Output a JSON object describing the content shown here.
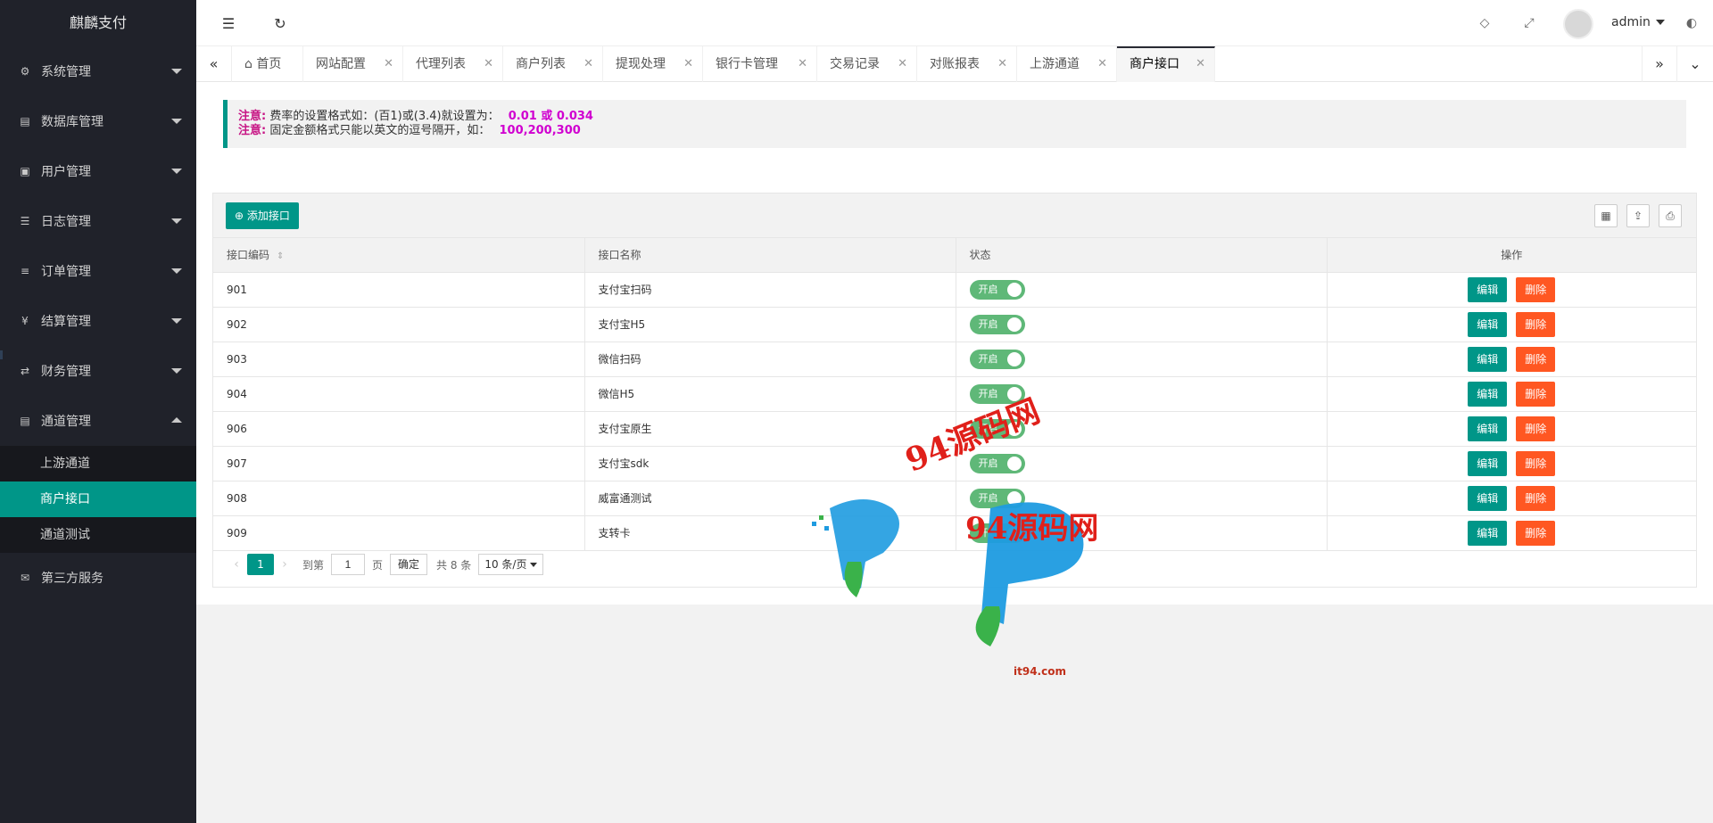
{
  "app": {
    "title": "麒麟支付"
  },
  "sidebar": {
    "items": [
      {
        "label": "系统管理",
        "icon": "gear-icon",
        "glyph": "⚙"
      },
      {
        "label": "数据库管理",
        "icon": "database-icon",
        "glyph": "▤"
      },
      {
        "label": "用户管理",
        "icon": "users-icon",
        "glyph": "▣"
      },
      {
        "label": "日志管理",
        "icon": "log-icon",
        "glyph": "☰"
      },
      {
        "label": "订单管理",
        "icon": "list-icon",
        "glyph": "≡"
      },
      {
        "label": "结算管理",
        "icon": "yen-icon",
        "glyph": "¥"
      },
      {
        "label": "财务管理",
        "icon": "exchange-icon",
        "glyph": "⇄"
      },
      {
        "label": "通道管理",
        "icon": "server-icon",
        "glyph": "▤",
        "expanded": true,
        "children": [
          {
            "label": "上游通道"
          },
          {
            "label": "商户接口",
            "active": true
          },
          {
            "label": "通道测试"
          }
        ]
      },
      {
        "label": "第三方服务",
        "icon": "mail-icon",
        "glyph": "✉"
      }
    ]
  },
  "header": {
    "username": "admin"
  },
  "tabs": {
    "items": [
      {
        "label": "首页",
        "home": true
      },
      {
        "label": "网站配置"
      },
      {
        "label": "代理列表"
      },
      {
        "label": "商户列表"
      },
      {
        "label": "提现处理"
      },
      {
        "label": "银行卡管理"
      },
      {
        "label": "交易记录"
      },
      {
        "label": "对账报表"
      },
      {
        "label": "上游通道"
      },
      {
        "label": "商户接口",
        "active": true
      }
    ]
  },
  "notice": {
    "line1": {
      "label": "注意:",
      "text": "费率的设置格式如：(百1)或(3.4)就设置为：",
      "highlight": "0.01 或 0.034"
    },
    "line2": {
      "label": "注意:",
      "text": "固定金额格式只能以英文的逗号隔开，如：",
      "highlight": "100,200,300"
    }
  },
  "toolbar": {
    "add_label": "添加接口"
  },
  "table": {
    "columns": [
      "接口编码",
      "接口名称",
      "状态",
      "操作"
    ],
    "rows": [
      {
        "code": "901",
        "name": "支付宝扫码",
        "status": "开启"
      },
      {
        "code": "902",
        "name": "支付宝H5",
        "status": "开启"
      },
      {
        "code": "903",
        "name": "微信扫码",
        "status": "开启"
      },
      {
        "code": "904",
        "name": "微信H5",
        "status": "开启"
      },
      {
        "code": "906",
        "name": "支付宝原生",
        "status": "开启"
      },
      {
        "code": "907",
        "name": "支付宝sdk",
        "status": "开启"
      },
      {
        "code": "908",
        "name": "威富通测试",
        "status": "开启"
      },
      {
        "code": "909",
        "name": "支转卡",
        "status": "开启"
      }
    ],
    "edit_label": "编辑",
    "delete_label": "删除"
  },
  "pager": {
    "current": "1",
    "goto_label": "到第",
    "input_value": "1",
    "page_unit": "页",
    "confirm_label": "确定",
    "total": "共 8 条",
    "per_page": "10 条/页"
  },
  "watermark": {
    "line1": "94源码网",
    "line2": "94源码网",
    "line3": "it94.com"
  },
  "colors": {
    "primary": "#009688",
    "danger": "#ff5722",
    "sidebar": "#20222a",
    "switch_on": "#5fb878"
  }
}
